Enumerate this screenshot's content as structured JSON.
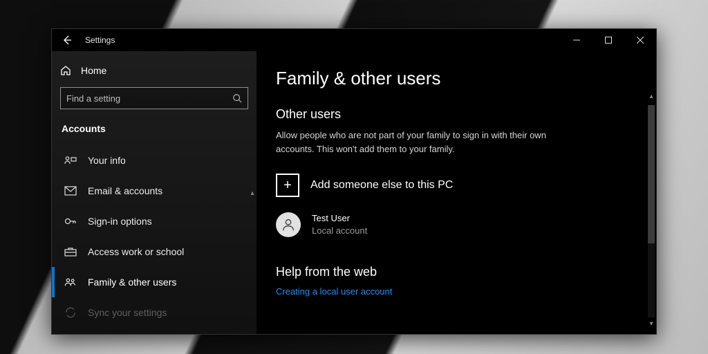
{
  "window": {
    "title": "Settings"
  },
  "sidebar": {
    "home": "Home",
    "search_placeholder": "Find a setting",
    "category": "Accounts",
    "items": [
      {
        "label": "Your info"
      },
      {
        "label": "Email & accounts"
      },
      {
        "label": "Sign-in options"
      },
      {
        "label": "Access work or school"
      },
      {
        "label": "Family & other users"
      },
      {
        "label": "Sync your settings"
      }
    ],
    "active_index": 4
  },
  "main": {
    "heading": "Family & other users",
    "other_users_heading": "Other users",
    "other_users_desc": "Allow people who are not part of your family to sign in with their own accounts. This won't add them to your family.",
    "add_label": "Add someone else to this PC",
    "user": {
      "name": "Test User",
      "type": "Local account"
    },
    "help_heading": "Help from the web",
    "help_link": "Creating a local user account"
  }
}
